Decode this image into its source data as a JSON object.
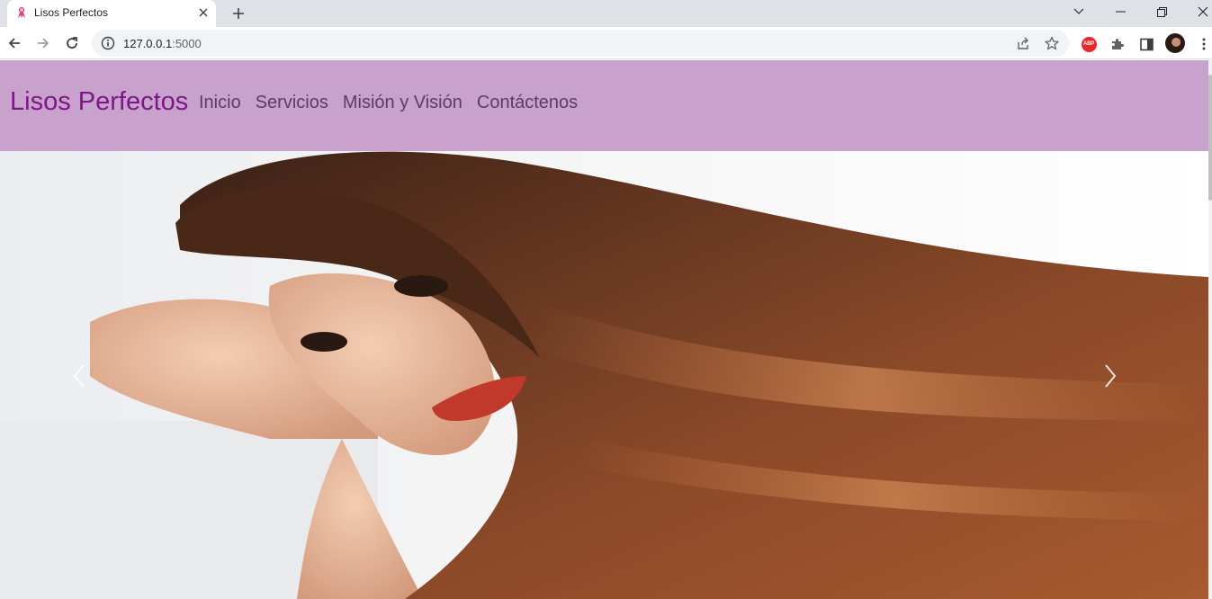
{
  "browser": {
    "tab": {
      "title": "Lisos Perfectos",
      "favicon": "ribbon-favicon-icon",
      "close_icon": "close-icon"
    },
    "new_tab_icon": "plus-icon",
    "window_controls": [
      "chevron-down-icon",
      "minimize-icon",
      "restore-icon",
      "close-icon"
    ],
    "toolbar": {
      "back_icon": "arrow-left-icon",
      "forward_icon": "arrow-right-icon",
      "reload_icon": "reload-icon",
      "site_info_icon": "info-icon",
      "url_host": "127.0.0.1",
      "url_port": ":5000",
      "share_icon": "share-icon",
      "bookmark_icon": "star-icon",
      "extensions": [
        {
          "name": "adblock-plus-icon",
          "label": "ABP"
        },
        {
          "name": "puzzle-icon"
        },
        {
          "name": "side-panel-icon"
        },
        {
          "name": "profile-avatar"
        }
      ],
      "menu_icon": "more-vertical-icon"
    }
  },
  "site": {
    "brand": "Lisos Perfectos",
    "nav": [
      {
        "label": "Inicio"
      },
      {
        "label": "Servicios"
      },
      {
        "label": "Misión y Visión"
      },
      {
        "label": "Contáctenos"
      }
    ],
    "carousel": {
      "image": "woman-with-long-straight-brown-hair",
      "prev_icon": "chevron-left-icon",
      "next_icon": "chevron-right-icon"
    }
  },
  "colors": {
    "navbar_bg": "#c8a2cc",
    "brand": "#7c1785",
    "nav_link": "#5a3d63",
    "tabbar_bg": "#dee1e6",
    "omnibox_bg": "#f1f3f4"
  }
}
